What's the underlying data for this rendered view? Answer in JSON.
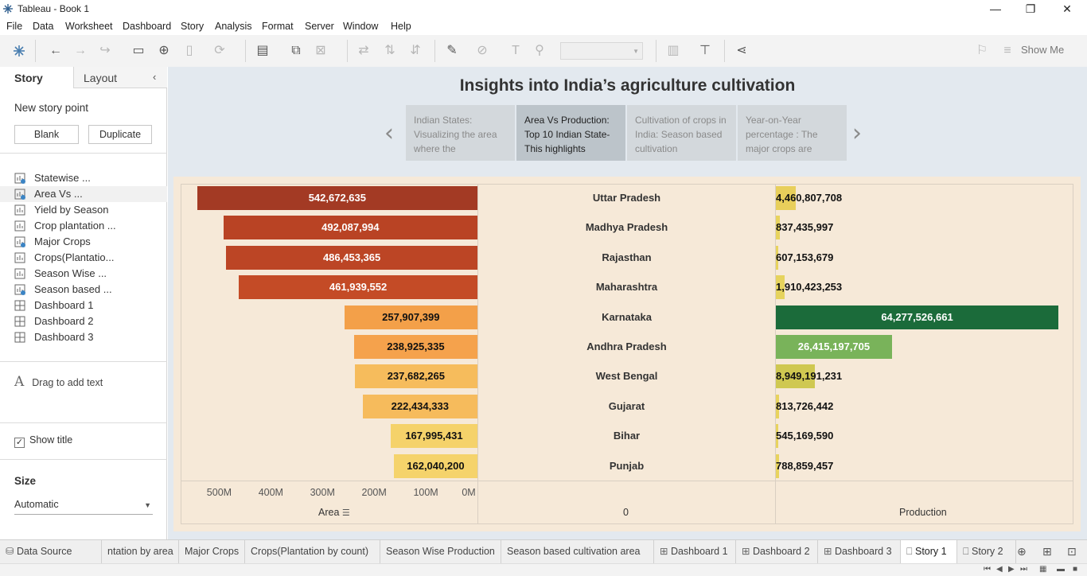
{
  "window": {
    "title": "Tableau - Book 1",
    "minimize": "—",
    "maximize": "❐",
    "close": "✕"
  },
  "menu": [
    "File",
    "Data",
    "Worksheet",
    "Dashboard",
    "Story",
    "Analysis",
    "Format",
    "Server",
    "Window",
    "Help"
  ],
  "toolbar": {
    "show_me": "Show Me"
  },
  "sidebar": {
    "tab_story": "Story",
    "tab_layout": "Layout",
    "new_story_point": "New story point",
    "blank_button": "Blank",
    "duplicate_button": "Duplicate",
    "sheets": [
      {
        "label": "Statewise ...",
        "type": "worksheet",
        "used": true
      },
      {
        "label": "Area Vs ...",
        "type": "worksheet",
        "used": true
      },
      {
        "label": "Yield by Season",
        "type": "worksheet",
        "used": false
      },
      {
        "label": "Crop plantation ...",
        "type": "worksheet",
        "used": false
      },
      {
        "label": "Major Crops",
        "type": "worksheet",
        "used": true
      },
      {
        "label": "Crops(Plantatio...",
        "type": "worksheet",
        "used": false
      },
      {
        "label": "Season Wise ...",
        "type": "worksheet",
        "used": false
      },
      {
        "label": "Season based ...",
        "type": "worksheet",
        "used": true
      },
      {
        "label": "Dashboard 1",
        "type": "dashboard",
        "used": false
      },
      {
        "label": "Dashboard 2",
        "type": "dashboard",
        "used": false
      },
      {
        "label": "Dashboard 3",
        "type": "dashboard",
        "used": false
      }
    ],
    "drag_text": "Drag to add text",
    "show_title": "Show title",
    "show_title_checked": true,
    "size_label": "Size",
    "size_value": "Automatic"
  },
  "story": {
    "title": "Insights into India’s agriculture cultivation",
    "points": [
      {
        "text": "Indian States: Visualizing the area where the",
        "active": false
      },
      {
        "text": "Area Vs Production: Top 10 Indian State- This highlights",
        "active": true
      },
      {
        "text": "Cultivation of crops in India: Season based cultivation",
        "active": false
      },
      {
        "text": "Year-on-Year percentage : The major crops are",
        "active": false
      }
    ]
  },
  "chart_data": {
    "type": "bar",
    "categories": [
      "Uttar Pradesh",
      "Madhya Pradesh",
      "Rajasthan",
      "Maharashtra",
      "Karnataka",
      "Andhra Pradesh",
      "West Bengal",
      "Gujarat",
      "Bihar",
      "Punjab"
    ],
    "area_labels": [
      "542,672,635",
      "492,087,994",
      "486,453,365",
      "461,939,552",
      "257,907,399",
      "238,925,335",
      "237,682,265",
      "222,434,333",
      "167,995,431",
      "162,040,200"
    ],
    "area_values": [
      542672635,
      492087994,
      486453365,
      461939552,
      257907399,
      238925335,
      237682265,
      222434333,
      167995431,
      162040200
    ],
    "area_colors": [
      "#a33a24",
      "#b94324",
      "#bc4525",
      "#c44b26",
      "#f3a049",
      "#f5a24c",
      "#f6bc5c",
      "#f6bb5c",
      "#f5d26a",
      "#f5d36b"
    ],
    "area_label_colors": [
      "#ffffff",
      "#ffffff",
      "#ffffff",
      "#ffffff",
      "#111111",
      "#111111",
      "#111111",
      "#111111",
      "#111111",
      "#111111"
    ],
    "production_labels": [
      "4,460,807,708",
      "837,435,997",
      "607,153,679",
      "1,910,423,253",
      "64,277,526,661",
      "26,415,197,705",
      "8,949,191,231",
      "813,726,442",
      "545,169,590",
      "788,859,457"
    ],
    "production_values": [
      4460807708,
      837435997,
      607153679,
      1910423253,
      64277526661,
      26415197705,
      8949191231,
      813726442,
      545169590,
      788859457
    ],
    "production_colors": [
      "#e8cf5b",
      "#e8d35e",
      "#e8d35e",
      "#e6d35d",
      "#1b6b3a",
      "#79b35a",
      "#cfc851",
      "#e8d35e",
      "#e8d35e",
      "#e8d35e"
    ],
    "area_ticks": [
      "500M",
      "400M",
      "300M",
      "200M",
      "100M",
      "0M"
    ],
    "area_tick_values": [
      500000000,
      400000000,
      300000000,
      200000000,
      100000000,
      0
    ],
    "area_axis_title": "Area",
    "middle_axis_title": "0",
    "production_axis_title": "Production",
    "area_max": 570000000,
    "production_max": 64277526661
  },
  "bottom_tabs": [
    {
      "label": "Data Source",
      "icon": "database-icon",
      "active": false
    },
    {
      "label": "ntation by area",
      "icon": "",
      "active": false
    },
    {
      "label": "Major Crops",
      "icon": "",
      "active": false
    },
    {
      "label": "Crops(Plantation by count)",
      "icon": "",
      "active": false
    },
    {
      "label": "Season Wise Production",
      "icon": "",
      "active": false
    },
    {
      "label": "Season based cultivation area",
      "icon": "",
      "active": false
    },
    {
      "label": "Dashboard 1",
      "icon": "dashboard-icon",
      "active": false
    },
    {
      "label": "Dashboard 2",
      "icon": "dashboard-icon",
      "active": false
    },
    {
      "label": "Dashboard 3",
      "icon": "dashboard-icon",
      "active": false
    },
    {
      "label": "Story 1",
      "icon": "story-icon",
      "active": true
    },
    {
      "label": "Story 2",
      "icon": "story-icon",
      "active": false
    }
  ]
}
